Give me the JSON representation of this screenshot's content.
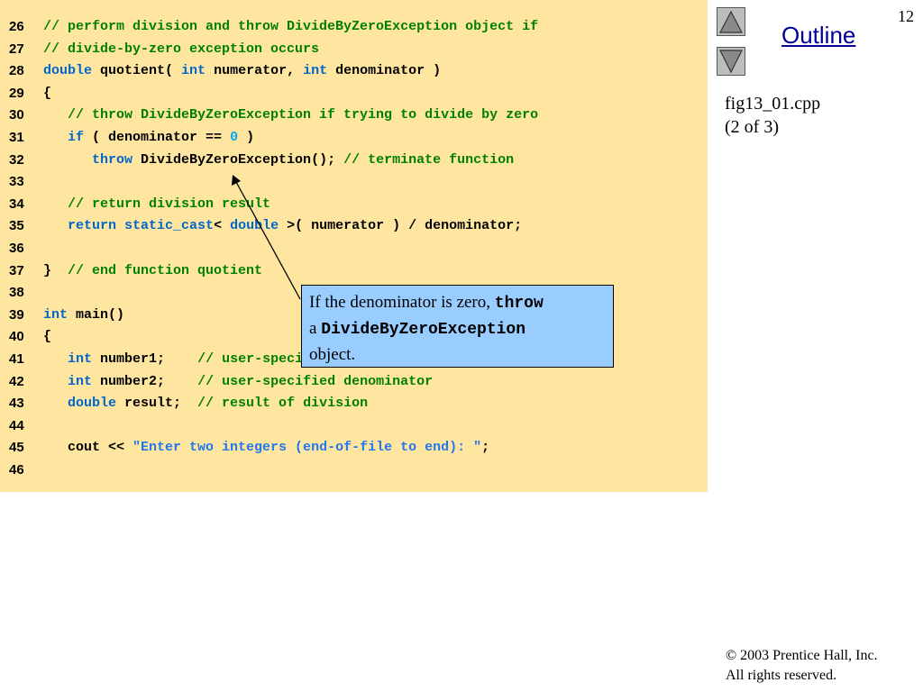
{
  "page_number": "12",
  "outline_label": "Outline",
  "slide_caption": {
    "file": "fig13_01.cpp",
    "part": "(2 of 3)"
  },
  "footer": {
    "copyright": "© 2003 Prentice Hall, Inc.",
    "rights": "All rights reserved."
  },
  "callout": {
    "text1": "If the denominator is zero, ",
    "code1": "throw",
    "text2": "a ",
    "code2": "DivideByZeroException",
    "text3": "object."
  },
  "code_lines": [
    {
      "n": "26",
      "tokens": [
        {
          "t": "// perform division and throw DivideByZeroException object if",
          "c": "comment"
        }
      ]
    },
    {
      "n": "27",
      "tokens": [
        {
          "t": "// divide-by-zero exception occurs",
          "c": "comment"
        }
      ]
    },
    {
      "n": "28",
      "tokens": [
        {
          "t": "double",
          "c": "kw"
        },
        {
          "t": " quotient( ",
          "c": "plain"
        },
        {
          "t": "int",
          "c": "kw"
        },
        {
          "t": " numerator, ",
          "c": "plain"
        },
        {
          "t": "int",
          "c": "kw"
        },
        {
          "t": " denominator )",
          "c": "plain"
        }
      ]
    },
    {
      "n": "29",
      "tokens": [
        {
          "t": "{",
          "c": "plain"
        }
      ]
    },
    {
      "n": "30",
      "tokens": [
        {
          "t": "   // throw DivideByZeroException if trying to divide by zero",
          "c": "comment"
        }
      ]
    },
    {
      "n": "31",
      "tokens": [
        {
          "t": "   ",
          "c": "plain"
        },
        {
          "t": "if",
          "c": "kw"
        },
        {
          "t": " ( denominator == ",
          "c": "plain"
        },
        {
          "t": "0",
          "c": "num"
        },
        {
          "t": " )",
          "c": "plain"
        }
      ]
    },
    {
      "n": "32",
      "tokens": [
        {
          "t": "      ",
          "c": "plain"
        },
        {
          "t": "throw",
          "c": "kw"
        },
        {
          "t": " DivideByZeroException(); ",
          "c": "plain"
        },
        {
          "t": "// terminate function",
          "c": "comment"
        }
      ]
    },
    {
      "n": "33",
      "tokens": []
    },
    {
      "n": "34",
      "tokens": [
        {
          "t": "   // return division result",
          "c": "comment"
        }
      ]
    },
    {
      "n": "35",
      "tokens": [
        {
          "t": "   ",
          "c": "plain"
        },
        {
          "t": "return",
          "c": "kw"
        },
        {
          "t": " ",
          "c": "plain"
        },
        {
          "t": "static_cast",
          "c": "kw"
        },
        {
          "t": "< ",
          "c": "plain"
        },
        {
          "t": "double",
          "c": "kw"
        },
        {
          "t": " >( numerator ) / denominator;",
          "c": "plain"
        }
      ]
    },
    {
      "n": "36",
      "tokens": []
    },
    {
      "n": "37",
      "tokens": [
        {
          "t": "}  ",
          "c": "plain"
        },
        {
          "t": "// end function quotient",
          "c": "comment"
        }
      ]
    },
    {
      "n": "38",
      "tokens": []
    },
    {
      "n": "39",
      "tokens": [
        {
          "t": "int",
          "c": "kw"
        },
        {
          "t": " main()",
          "c": "plain"
        }
      ]
    },
    {
      "n": "40",
      "tokens": [
        {
          "t": "{",
          "c": "plain"
        }
      ]
    },
    {
      "n": "41",
      "tokens": [
        {
          "t": "   ",
          "c": "plain"
        },
        {
          "t": "int",
          "c": "kw"
        },
        {
          "t": " number1;    ",
          "c": "plain"
        },
        {
          "t": "// user-specified numerator",
          "c": "comment"
        }
      ]
    },
    {
      "n": "42",
      "tokens": [
        {
          "t": "   ",
          "c": "plain"
        },
        {
          "t": "int",
          "c": "kw"
        },
        {
          "t": " number2;    ",
          "c": "plain"
        },
        {
          "t": "// user-specified denominator",
          "c": "comment"
        }
      ]
    },
    {
      "n": "43",
      "tokens": [
        {
          "t": "   ",
          "c": "plain"
        },
        {
          "t": "double",
          "c": "kw"
        },
        {
          "t": " result;  ",
          "c": "plain"
        },
        {
          "t": "// result of division",
          "c": "comment"
        }
      ]
    },
    {
      "n": "44",
      "tokens": []
    },
    {
      "n": "45",
      "tokens": [
        {
          "t": "   cout << ",
          "c": "plain"
        },
        {
          "t": "\"Enter two integers (end-of-file to end): \"",
          "c": "string"
        },
        {
          "t": ";",
          "c": "plain"
        }
      ]
    },
    {
      "n": "46",
      "tokens": []
    }
  ],
  "colors": {
    "code_background": "#ffe6a0",
    "keyword": "#0066cc",
    "comment": "#008000",
    "string": "#2277ee",
    "callout_background": "#99ccff",
    "outline_link": "#000099"
  },
  "icons": {
    "prev": "triangle-up-icon",
    "next": "triangle-down-icon"
  }
}
